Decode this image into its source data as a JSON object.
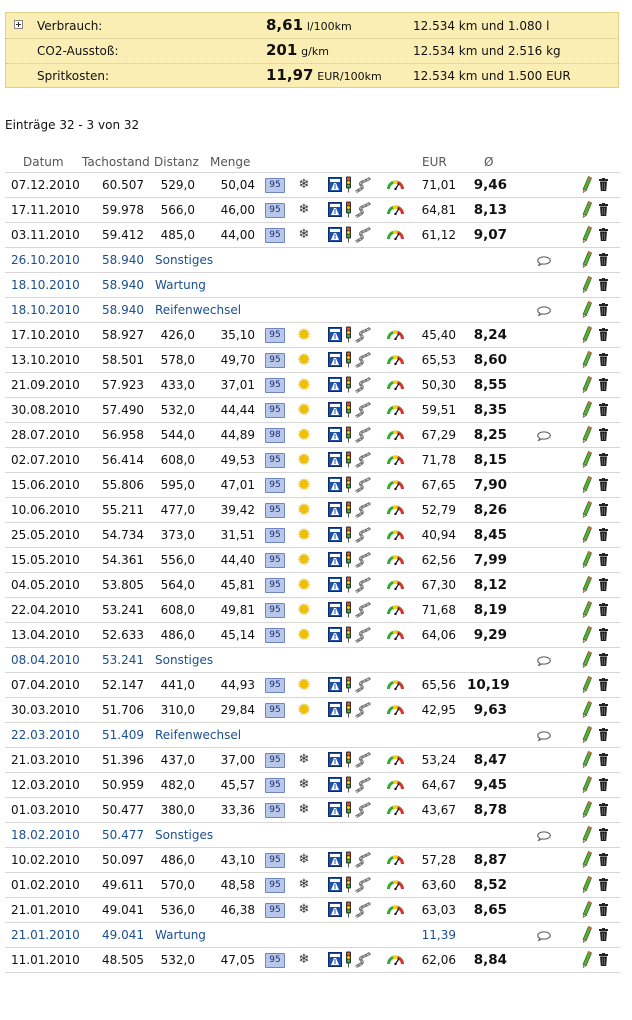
{
  "summary": {
    "rows": [
      {
        "label": "Verbrauch:",
        "value": "8,61",
        "unit": "l/100km",
        "detail": "12.534 km und 1.080 l"
      },
      {
        "label": "CO2-Ausstoß:",
        "value": "201",
        "unit": "g/km",
        "detail": "12.534 km und 2.516 kg"
      },
      {
        "label": "Spritkosten:",
        "value": "11,97",
        "unit": "EUR/100km",
        "detail": "12.534 km und 1.500 EUR"
      }
    ]
  },
  "entries_info": "Einträge 32 - 3 von 32",
  "headers": {
    "date": "Datum",
    "odometer": "Tachostand",
    "distance": "Distanz",
    "quantity": "Menge",
    "eur": "EUR",
    "avg": "Ø"
  },
  "colors": {
    "summary_bg": "#fbeeb4",
    "service_text": "#1b4f8f",
    "fuel_badge": "#b9c8ea"
  },
  "rows": [
    {
      "type": "fuel",
      "date": "07.12.2010",
      "odometer": "60.507",
      "distance": "529,0",
      "quantity": "50,04",
      "fuel": "95",
      "season": "winter",
      "eur": "71,01",
      "avg": "9,46"
    },
    {
      "type": "fuel",
      "date": "17.11.2010",
      "odometer": "59.978",
      "distance": "566,0",
      "quantity": "46,00",
      "fuel": "95",
      "season": "winter",
      "eur": "64,81",
      "avg": "8,13"
    },
    {
      "type": "fuel",
      "date": "03.11.2010",
      "odometer": "59.412",
      "distance": "485,0",
      "quantity": "44,00",
      "fuel": "95",
      "season": "winter",
      "eur": "61,12",
      "avg": "9,07"
    },
    {
      "type": "service",
      "date": "26.10.2010",
      "odometer": "58.940",
      "note": "Sonstiges",
      "eur": "",
      "comment": true
    },
    {
      "type": "service",
      "date": "18.10.2010",
      "odometer": "58.940",
      "note": "Wartung",
      "eur": "",
      "comment": false
    },
    {
      "type": "service",
      "date": "18.10.2010",
      "odometer": "58.940",
      "note": "Reifenwechsel",
      "eur": "",
      "comment": true
    },
    {
      "type": "fuel",
      "date": "17.10.2010",
      "odometer": "58.927",
      "distance": "426,0",
      "quantity": "35,10",
      "fuel": "95",
      "season": "summer",
      "eur": "45,40",
      "avg": "8,24"
    },
    {
      "type": "fuel",
      "date": "13.10.2010",
      "odometer": "58.501",
      "distance": "578,0",
      "quantity": "49,70",
      "fuel": "95",
      "season": "summer",
      "eur": "65,53",
      "avg": "8,60"
    },
    {
      "type": "fuel",
      "date": "21.09.2010",
      "odometer": "57.923",
      "distance": "433,0",
      "quantity": "37,01",
      "fuel": "95",
      "season": "summer",
      "eur": "50,30",
      "avg": "8,55"
    },
    {
      "type": "fuel",
      "date": "30.08.2010",
      "odometer": "57.490",
      "distance": "532,0",
      "quantity": "44,44",
      "fuel": "95",
      "season": "summer",
      "eur": "59,51",
      "avg": "8,35"
    },
    {
      "type": "fuel",
      "date": "28.07.2010",
      "odometer": "56.958",
      "distance": "544,0",
      "quantity": "44,89",
      "fuel": "98",
      "season": "summer",
      "eur": "67,29",
      "avg": "8,25",
      "comment": true
    },
    {
      "type": "fuel",
      "date": "02.07.2010",
      "odometer": "56.414",
      "distance": "608,0",
      "quantity": "49,53",
      "fuel": "95",
      "season": "summer",
      "eur": "71,78",
      "avg": "8,15"
    },
    {
      "type": "fuel",
      "date": "15.06.2010",
      "odometer": "55.806",
      "distance": "595,0",
      "quantity": "47,01",
      "fuel": "95",
      "season": "summer",
      "eur": "67,65",
      "avg": "7,90"
    },
    {
      "type": "fuel",
      "date": "10.06.2010",
      "odometer": "55.211",
      "distance": "477,0",
      "quantity": "39,42",
      "fuel": "95",
      "season": "summer",
      "eur": "52,79",
      "avg": "8,26"
    },
    {
      "type": "fuel",
      "date": "25.05.2010",
      "odometer": "54.734",
      "distance": "373,0",
      "quantity": "31,51",
      "fuel": "95",
      "season": "summer",
      "eur": "40,94",
      "avg": "8,45"
    },
    {
      "type": "fuel",
      "date": "15.05.2010",
      "odometer": "54.361",
      "distance": "556,0",
      "quantity": "44,40",
      "fuel": "95",
      "season": "summer",
      "eur": "62,56",
      "avg": "7,99"
    },
    {
      "type": "fuel",
      "date": "04.05.2010",
      "odometer": "53.805",
      "distance": "564,0",
      "quantity": "45,81",
      "fuel": "95",
      "season": "summer",
      "eur": "67,30",
      "avg": "8,12"
    },
    {
      "type": "fuel",
      "date": "22.04.2010",
      "odometer": "53.241",
      "distance": "608,0",
      "quantity": "49,81",
      "fuel": "95",
      "season": "summer",
      "eur": "71,68",
      "avg": "8,19"
    },
    {
      "type": "fuel",
      "date": "13.04.2010",
      "odometer": "52.633",
      "distance": "486,0",
      "quantity": "45,14",
      "fuel": "95",
      "season": "summer",
      "eur": "64,06",
      "avg": "9,29"
    },
    {
      "type": "service",
      "date": "08.04.2010",
      "odometer": "53.241",
      "note": "Sonstiges",
      "eur": "",
      "comment": true
    },
    {
      "type": "fuel",
      "date": "07.04.2010",
      "odometer": "52.147",
      "distance": "441,0",
      "quantity": "44,93",
      "fuel": "95",
      "season": "summer",
      "eur": "65,56",
      "avg": "10,19"
    },
    {
      "type": "fuel",
      "date": "30.03.2010",
      "odometer": "51.706",
      "distance": "310,0",
      "quantity": "29,84",
      "fuel": "95",
      "season": "summer",
      "eur": "42,95",
      "avg": "9,63"
    },
    {
      "type": "service",
      "date": "22.03.2010",
      "odometer": "51.409",
      "note": "Reifenwechsel",
      "eur": "",
      "comment": true
    },
    {
      "type": "fuel",
      "date": "21.03.2010",
      "odometer": "51.396",
      "distance": "437,0",
      "quantity": "37,00",
      "fuel": "95",
      "season": "winter",
      "eur": "53,24",
      "avg": "8,47"
    },
    {
      "type": "fuel",
      "date": "12.03.2010",
      "odometer": "50.959",
      "distance": "482,0",
      "quantity": "45,57",
      "fuel": "95",
      "season": "winter",
      "eur": "64,67",
      "avg": "9,45"
    },
    {
      "type": "fuel",
      "date": "01.03.2010",
      "odometer": "50.477",
      "distance": "380,0",
      "quantity": "33,36",
      "fuel": "95",
      "season": "winter",
      "eur": "43,67",
      "avg": "8,78"
    },
    {
      "type": "service",
      "date": "18.02.2010",
      "odometer": "50.477",
      "note": "Sonstiges",
      "eur": "",
      "comment": true
    },
    {
      "type": "fuel",
      "date": "10.02.2010",
      "odometer": "50.097",
      "distance": "486,0",
      "quantity": "43,10",
      "fuel": "95",
      "season": "winter",
      "eur": "57,28",
      "avg": "8,87"
    },
    {
      "type": "fuel",
      "date": "01.02.2010",
      "odometer": "49.611",
      "distance": "570,0",
      "quantity": "48,58",
      "fuel": "95",
      "season": "winter",
      "eur": "63,60",
      "avg": "8,52"
    },
    {
      "type": "fuel",
      "date": "21.01.2010",
      "odometer": "49.041",
      "distance": "536,0",
      "quantity": "46,38",
      "fuel": "95",
      "season": "winter",
      "eur": "63,03",
      "avg": "8,65"
    },
    {
      "type": "service",
      "date": "21.01.2010",
      "odometer": "49.041",
      "note": "Wartung",
      "eur": "11,39",
      "comment": true
    },
    {
      "type": "fuel",
      "date": "11.01.2010",
      "odometer": "48.505",
      "distance": "532,0",
      "quantity": "47,05",
      "fuel": "95",
      "season": "winter",
      "eur": "62,06",
      "avg": "8,84"
    }
  ]
}
